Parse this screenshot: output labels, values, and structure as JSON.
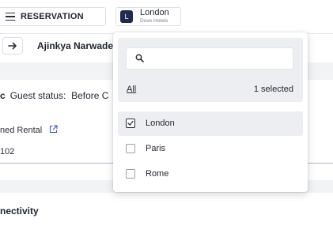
{
  "topbar": {
    "reservation_label": "RESERVATION",
    "hotel": {
      "avatar_letter": "L",
      "name": "London",
      "subtitle": "Duve Hotels"
    }
  },
  "guest": {
    "name": "Ajinkya Narwade"
  },
  "status": {
    "prefix": "c",
    "label": "Guest status:",
    "value": "Before C"
  },
  "rental": {
    "label": "ned Rental",
    "value": "102"
  },
  "section": {
    "connectivity": "nectivity"
  },
  "dropdown": {
    "search_placeholder": "",
    "all_label": "All",
    "selected_count": "1 selected",
    "options": [
      {
        "label": "London",
        "checked": true
      },
      {
        "label": "Paris",
        "checked": false
      },
      {
        "label": "Rome",
        "checked": false
      }
    ]
  },
  "colors": {
    "avatar_bg": "#1e2a52",
    "panel_bg": "#eceef1"
  }
}
